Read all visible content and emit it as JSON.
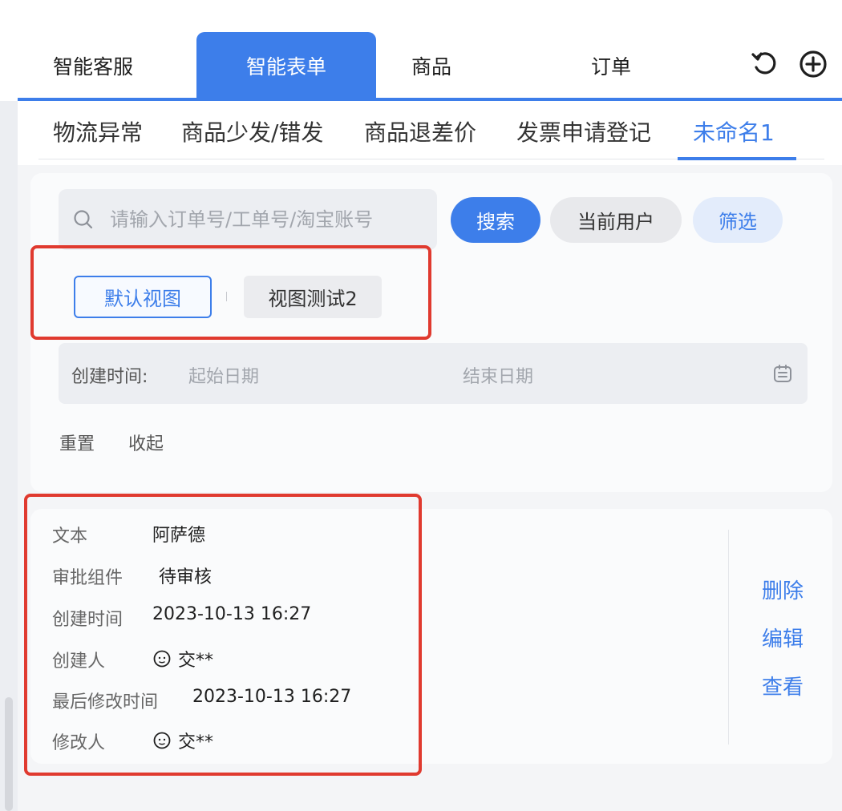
{
  "top_tabs": [
    {
      "label": "智能客服"
    },
    {
      "label": "智能表单"
    },
    {
      "label": "商品"
    },
    {
      "label": "订单"
    }
  ],
  "top_icons": {
    "refresh": "refresh-icon",
    "add": "plus-circle-icon"
  },
  "sub_tabs": [
    {
      "label": "物流异常"
    },
    {
      "label": "商品少发/错发"
    },
    {
      "label": "商品退差价"
    },
    {
      "label": "发票申请登记"
    },
    {
      "label": "未命名1"
    }
  ],
  "search": {
    "placeholder": "请输入订单号/工单号/淘宝账号",
    "value": ""
  },
  "buttons": {
    "search": "搜索",
    "current_user": "当前用户",
    "filter": "筛选",
    "reset": "重置",
    "collapse": "收起"
  },
  "views": {
    "default": "默认视图",
    "test": "视图测试2"
  },
  "date_filter": {
    "label": "创建时间:",
    "start_placeholder": "起始日期",
    "end_placeholder": "结束日期"
  },
  "record": {
    "fields": [
      {
        "label": "文本",
        "value": "阿萨德"
      },
      {
        "label": "审批组件",
        "value": "待审核"
      },
      {
        "label": "创建时间",
        "value": "2023-10-13 16:27"
      },
      {
        "label": "创建人",
        "value": "交**"
      },
      {
        "label": "最后修改时间",
        "value": "2023-10-13 16:27"
      },
      {
        "label": "修改人",
        "value": "交**"
      }
    ],
    "actions": {
      "delete": "删除",
      "edit": "编辑",
      "view": "查看"
    }
  },
  "colors": {
    "accent": "#3d7eea",
    "highlight": "#e03a2f"
  }
}
